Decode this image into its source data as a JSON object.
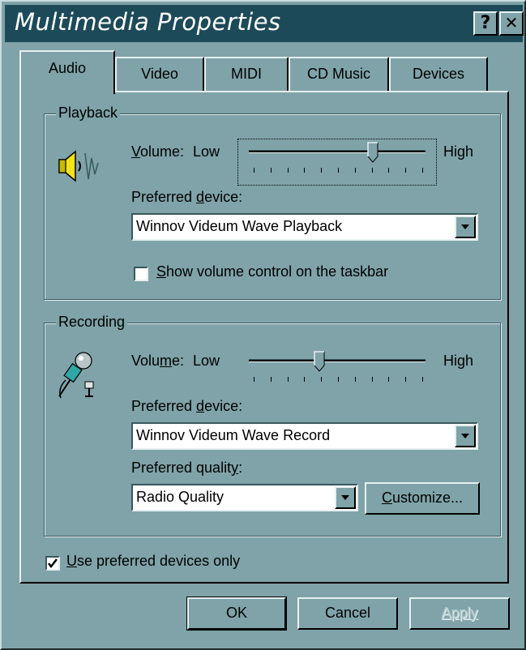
{
  "window": {
    "title": "Multimedia Properties",
    "help_label": "?",
    "close_label": "✕"
  },
  "tabs": [
    {
      "label": "Audio",
      "active": true
    },
    {
      "label": "Video"
    },
    {
      "label": "MIDI"
    },
    {
      "label": "CD Music"
    },
    {
      "label": "Devices"
    }
  ],
  "playback": {
    "legend": "Playback",
    "volume_prefix": "V",
    "volume_rest": "olume:",
    "low": "Low",
    "high": "High",
    "volume_level": 0.7,
    "device_label_pre": "Preferred ",
    "device_label_mn": "d",
    "device_label_post": "evice:",
    "device_value": "Winnov Videum Wave Playback",
    "show_volume_mn": "S",
    "show_volume_rest": "how volume control on the taskbar",
    "show_volume_checked": false
  },
  "recording": {
    "legend": "Recording",
    "volume_pre": "Volu",
    "volume_mn": "m",
    "volume_post": "e:",
    "low": "Low",
    "high": "High",
    "volume_level": 0.4,
    "device_label_pre": "Preferred ",
    "device_label_mn": "d",
    "device_label_post": "evice:",
    "device_value": "Winnov Videum Wave Record",
    "quality_label_pre": "Preferred qualit",
    "quality_label_mn": "y",
    "quality_label_post": ":",
    "quality_value": "Radio Quality",
    "customize_mn": "C",
    "customize_rest": "ustomize..."
  },
  "preferred_only": {
    "mn": "U",
    "rest": "se preferred devices only",
    "checked": true
  },
  "buttons": {
    "ok": "OK",
    "cancel": "Cancel",
    "apply": "Apply"
  },
  "colors": {
    "face": "#7FA3A8",
    "titlebar": "#1C4A58"
  }
}
